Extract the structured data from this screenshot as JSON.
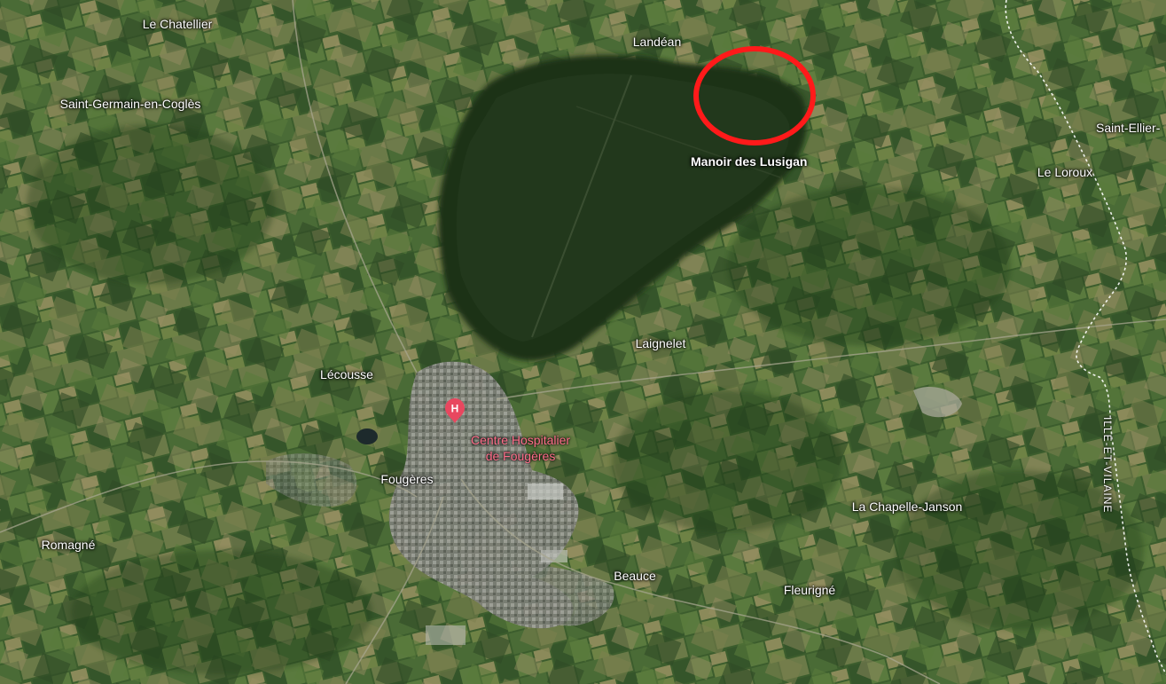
{
  "map": {
    "view": "satellite",
    "places": [
      {
        "id": "le-chatellier",
        "label": "Le Chatellier"
      },
      {
        "id": "saint-germain",
        "label": "Saint-Germain-en-Coglès"
      },
      {
        "id": "landean",
        "label": "Landéan"
      },
      {
        "id": "saint-ellier",
        "label": "Saint-Ellier-"
      },
      {
        "id": "le-loroux",
        "label": "Le Loroux"
      },
      {
        "id": "laignelet",
        "label": "Laignelet"
      },
      {
        "id": "lecousse",
        "label": "Lécousse"
      },
      {
        "id": "fougeres",
        "label": "Fougères"
      },
      {
        "id": "romagne",
        "label": "Romagné"
      },
      {
        "id": "la-chapelle-janson",
        "label": "La Chapelle-Janson"
      },
      {
        "id": "beauce",
        "label": "Beauce"
      },
      {
        "id": "fleurigne",
        "label": "Fleurigné"
      }
    ],
    "poi": {
      "name_line1": "Centre Hospitalier",
      "name_line2": "de Fougères",
      "icon": "hospital-pin-icon",
      "icon_letter": "H",
      "color": "#e8475f"
    },
    "highlight": {
      "label": "Manoir des Lusigan",
      "circle_color": "#ff1a1a"
    },
    "region_label": "ILLE-ET-VILAINE",
    "colors": {
      "farmland": "#3f6230",
      "forest": "#1f3219",
      "urban": "#8b8d88",
      "border": "#ffffff"
    }
  }
}
